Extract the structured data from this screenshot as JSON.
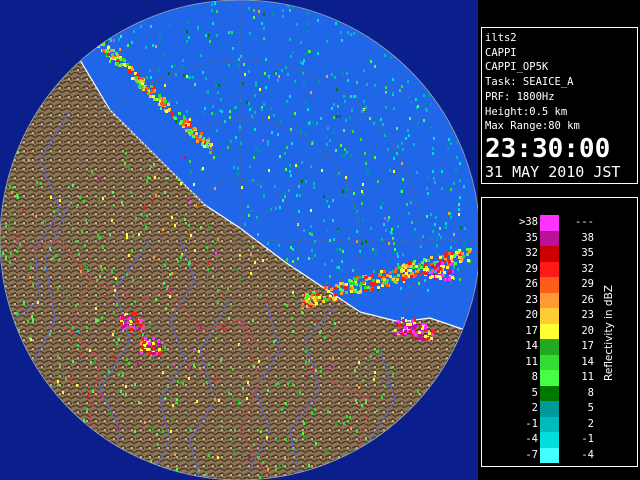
{
  "colors": {
    "background": "#000000",
    "sea": "#1f66e8",
    "sky_outside": "#0a1e8c",
    "land": "#8a7356",
    "ridge": "#5a4530",
    "river": "#5060d0",
    "boundary": "#c04050",
    "grid": "#6a6a6a"
  },
  "info": {
    "site": "ilts2",
    "product": "CAPPI",
    "product_id": "CAPPI_OP5K",
    "task": "Task: SEAICE_A",
    "prf": "PRF: 1800Hz",
    "height": "Height:0.5 km",
    "max_range": "Max Range:80 km",
    "time": "23:30:00",
    "date": "31 MAY 2010 JST"
  },
  "legend": {
    "unit": "Reflectivity in dBZ",
    "rows": [
      {
        "lo": ">38",
        "hi": "---",
        "color": "#ff33ff"
      },
      {
        "lo": "35",
        "hi": "38",
        "color": "#bb1199"
      },
      {
        "lo": "32",
        "hi": "35",
        "color": "#cc0000"
      },
      {
        "lo": "29",
        "hi": "32",
        "color": "#ff1a1a"
      },
      {
        "lo": "26",
        "hi": "29",
        "color": "#ff5c1a"
      },
      {
        "lo": "23",
        "hi": "26",
        "color": "#ff9933"
      },
      {
        "lo": "20",
        "hi": "23",
        "color": "#ffcc33"
      },
      {
        "lo": "17",
        "hi": "20",
        "color": "#ffff33"
      },
      {
        "lo": "14",
        "hi": "17",
        "color": "#22aa22"
      },
      {
        "lo": "11",
        "hi": "14",
        "color": "#33dd33"
      },
      {
        "lo": "8",
        "hi": "11",
        "color": "#44ff44"
      },
      {
        "lo": "5",
        "hi": "8",
        "color": "#007700"
      },
      {
        "lo": "2",
        "hi": "5",
        "color": "#009999"
      },
      {
        "lo": "-1",
        "hi": "2",
        "color": "#00bbbb"
      },
      {
        "lo": "-4",
        "hi": "-1",
        "color": "#00dddd"
      },
      {
        "lo": "-7",
        "hi": "-4",
        "color": "#44ffff"
      }
    ]
  }
}
